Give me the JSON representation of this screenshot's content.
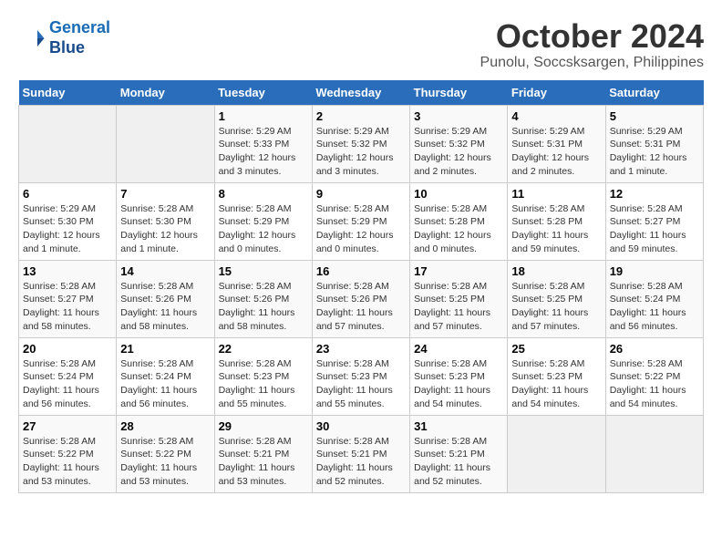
{
  "header": {
    "logo_line1": "General",
    "logo_line2": "Blue",
    "month_year": "October 2024",
    "location": "Punolu, Soccsksargen, Philippines"
  },
  "weekdays": [
    "Sunday",
    "Monday",
    "Tuesday",
    "Wednesday",
    "Thursday",
    "Friday",
    "Saturday"
  ],
  "weeks": [
    [
      {
        "day": "",
        "info": ""
      },
      {
        "day": "",
        "info": ""
      },
      {
        "day": "1",
        "info": "Sunrise: 5:29 AM\nSunset: 5:33 PM\nDaylight: 12 hours\nand 3 minutes."
      },
      {
        "day": "2",
        "info": "Sunrise: 5:29 AM\nSunset: 5:32 PM\nDaylight: 12 hours\nand 3 minutes."
      },
      {
        "day": "3",
        "info": "Sunrise: 5:29 AM\nSunset: 5:32 PM\nDaylight: 12 hours\nand 2 minutes."
      },
      {
        "day": "4",
        "info": "Sunrise: 5:29 AM\nSunset: 5:31 PM\nDaylight: 12 hours\nand 2 minutes."
      },
      {
        "day": "5",
        "info": "Sunrise: 5:29 AM\nSunset: 5:31 PM\nDaylight: 12 hours\nand 1 minute."
      }
    ],
    [
      {
        "day": "6",
        "info": "Sunrise: 5:29 AM\nSunset: 5:30 PM\nDaylight: 12 hours\nand 1 minute."
      },
      {
        "day": "7",
        "info": "Sunrise: 5:28 AM\nSunset: 5:30 PM\nDaylight: 12 hours\nand 1 minute."
      },
      {
        "day": "8",
        "info": "Sunrise: 5:28 AM\nSunset: 5:29 PM\nDaylight: 12 hours\nand 0 minutes."
      },
      {
        "day": "9",
        "info": "Sunrise: 5:28 AM\nSunset: 5:29 PM\nDaylight: 12 hours\nand 0 minutes."
      },
      {
        "day": "10",
        "info": "Sunrise: 5:28 AM\nSunset: 5:28 PM\nDaylight: 12 hours\nand 0 minutes."
      },
      {
        "day": "11",
        "info": "Sunrise: 5:28 AM\nSunset: 5:28 PM\nDaylight: 11 hours\nand 59 minutes."
      },
      {
        "day": "12",
        "info": "Sunrise: 5:28 AM\nSunset: 5:27 PM\nDaylight: 11 hours\nand 59 minutes."
      }
    ],
    [
      {
        "day": "13",
        "info": "Sunrise: 5:28 AM\nSunset: 5:27 PM\nDaylight: 11 hours\nand 58 minutes."
      },
      {
        "day": "14",
        "info": "Sunrise: 5:28 AM\nSunset: 5:26 PM\nDaylight: 11 hours\nand 58 minutes."
      },
      {
        "day": "15",
        "info": "Sunrise: 5:28 AM\nSunset: 5:26 PM\nDaylight: 11 hours\nand 58 minutes."
      },
      {
        "day": "16",
        "info": "Sunrise: 5:28 AM\nSunset: 5:26 PM\nDaylight: 11 hours\nand 57 minutes."
      },
      {
        "day": "17",
        "info": "Sunrise: 5:28 AM\nSunset: 5:25 PM\nDaylight: 11 hours\nand 57 minutes."
      },
      {
        "day": "18",
        "info": "Sunrise: 5:28 AM\nSunset: 5:25 PM\nDaylight: 11 hours\nand 57 minutes."
      },
      {
        "day": "19",
        "info": "Sunrise: 5:28 AM\nSunset: 5:24 PM\nDaylight: 11 hours\nand 56 minutes."
      }
    ],
    [
      {
        "day": "20",
        "info": "Sunrise: 5:28 AM\nSunset: 5:24 PM\nDaylight: 11 hours\nand 56 minutes."
      },
      {
        "day": "21",
        "info": "Sunrise: 5:28 AM\nSunset: 5:24 PM\nDaylight: 11 hours\nand 56 minutes."
      },
      {
        "day": "22",
        "info": "Sunrise: 5:28 AM\nSunset: 5:23 PM\nDaylight: 11 hours\nand 55 minutes."
      },
      {
        "day": "23",
        "info": "Sunrise: 5:28 AM\nSunset: 5:23 PM\nDaylight: 11 hours\nand 55 minutes."
      },
      {
        "day": "24",
        "info": "Sunrise: 5:28 AM\nSunset: 5:23 PM\nDaylight: 11 hours\nand 54 minutes."
      },
      {
        "day": "25",
        "info": "Sunrise: 5:28 AM\nSunset: 5:23 PM\nDaylight: 11 hours\nand 54 minutes."
      },
      {
        "day": "26",
        "info": "Sunrise: 5:28 AM\nSunset: 5:22 PM\nDaylight: 11 hours\nand 54 minutes."
      }
    ],
    [
      {
        "day": "27",
        "info": "Sunrise: 5:28 AM\nSunset: 5:22 PM\nDaylight: 11 hours\nand 53 minutes."
      },
      {
        "day": "28",
        "info": "Sunrise: 5:28 AM\nSunset: 5:22 PM\nDaylight: 11 hours\nand 53 minutes."
      },
      {
        "day": "29",
        "info": "Sunrise: 5:28 AM\nSunset: 5:21 PM\nDaylight: 11 hours\nand 53 minutes."
      },
      {
        "day": "30",
        "info": "Sunrise: 5:28 AM\nSunset: 5:21 PM\nDaylight: 11 hours\nand 52 minutes."
      },
      {
        "day": "31",
        "info": "Sunrise: 5:28 AM\nSunset: 5:21 PM\nDaylight: 11 hours\nand 52 minutes."
      },
      {
        "day": "",
        "info": ""
      },
      {
        "day": "",
        "info": ""
      }
    ]
  ]
}
